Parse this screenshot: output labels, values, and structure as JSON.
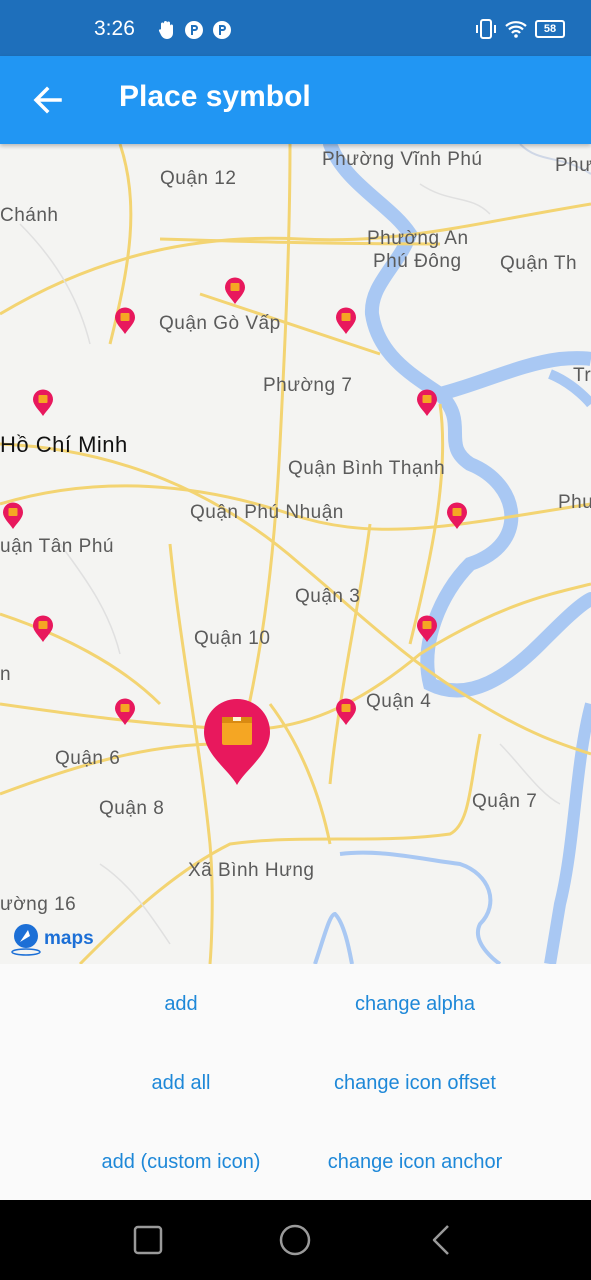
{
  "status_bar": {
    "time": "3:26",
    "battery": "58",
    "left_icons": [
      "hand-icon",
      "notification-p-icon",
      "notification-p-icon"
    ],
    "right_icons": [
      "vibrate-icon",
      "wifi-icon",
      "battery-icon"
    ]
  },
  "app_bar": {
    "title": "Place symbol",
    "back_icon": "arrow-left-icon",
    "color": "#2196f3"
  },
  "map": {
    "labels": {
      "phuong_vinh_phu": "Phường Vĩnh Phú",
      "phu_right_top": "Phư",
      "quan_12": "Quận 12",
      "chanh": "Chánh",
      "phuong_an_phu_dong_1": "Phường An",
      "phuong_an_phu_dong_2": "Phú Đông",
      "quan_th": "Quận Th",
      "quan_go_vap": "Quận Gò Vấp",
      "tr": "Tr",
      "phuong_7": "Phường 7",
      "ho_chi_minh": "Hồ Chí Minh",
      "quan_binh_thanh": "Quận Bình Thạnh",
      "phu_right_mid": "Phu",
      "quan_phu_nhuan": "Quận Phú Nhuận",
      "quan_tan_phu": "uận Tân Phú",
      "quan_3": "Quận 3",
      "quan_10": "Quận 10",
      "n_left": "n",
      "quan_4": "Quận 4",
      "quan_6": "Quận 6",
      "quan_8": "Quận 8",
      "quan_7": "Quận 7",
      "xa_binh_hung": "Xã Bình Hưng",
      "phuong_16": "ường 16"
    },
    "logo_text": "maps",
    "pin_color": "#e8185d",
    "icon_color": "#f5a623"
  },
  "buttons": {
    "add": "add",
    "change_alpha": "change alpha",
    "add_all": "add all",
    "change_icon_offset": "change icon offset",
    "add_custom_icon": "add (custom icon)",
    "change_icon_anchor": "change icon anchor"
  },
  "nav_bar": {
    "recents_icon": "square-icon",
    "home_icon": "circle-icon",
    "back_icon": "triangle-back-icon"
  }
}
